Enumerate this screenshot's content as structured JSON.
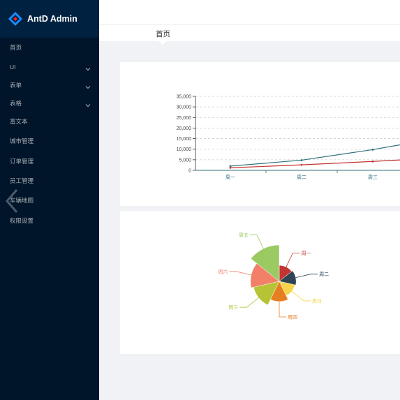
{
  "app": {
    "title": "AntD Admin"
  },
  "sidebar": {
    "items": [
      {
        "label": "首页",
        "has_submenu": false
      },
      {
        "label": "UI",
        "has_submenu": true
      },
      {
        "label": "表单",
        "has_submenu": true
      },
      {
        "label": "表格",
        "has_submenu": true
      },
      {
        "label": "富文本",
        "has_submenu": false
      },
      {
        "label": "城市管理",
        "has_submenu": false
      },
      {
        "label": "订单管理",
        "has_submenu": false
      },
      {
        "label": "员工管理",
        "has_submenu": false
      },
      {
        "label": "车辆地图",
        "has_submenu": false
      },
      {
        "label": "权限设置",
        "has_submenu": false
      }
    ]
  },
  "breadcrumb": {
    "title": "首页"
  },
  "colors": {
    "sidebar_bg": "#001529",
    "logo_bg": "#002140",
    "page_bg": "#f0f2f5",
    "logo_blue": "#1890ff",
    "logo_red": "#f5222d"
  },
  "chart_data": [
    {
      "type": "line",
      "categories": [
        "周一",
        "周二",
        "周三"
      ],
      "y_ticks": [
        "0",
        "5,000",
        "10,000",
        "15,000",
        "20,000",
        "25,000",
        "30,000",
        "35,000"
      ],
      "ylim": [
        0,
        35000
      ],
      "grid": true,
      "series": [
        {
          "color": "#2f6f7a",
          "values": [
            2000,
            4800,
            9800
          ]
        },
        {
          "color": "#c23531",
          "values": [
            1200,
            2600,
            4200
          ]
        }
      ]
    },
    {
      "type": "pie",
      "style": "rose",
      "slices": [
        {
          "label": "周一",
          "value": 5,
          "color": "#c23531"
        },
        {
          "label": "周二",
          "value": 6,
          "color": "#2f4554"
        },
        {
          "label": "周日",
          "value": 5,
          "color": "#f6d54a"
        },
        {
          "label": "周四",
          "value": 10,
          "color": "#e67e22"
        },
        {
          "label": "周三",
          "value": 20,
          "color": "#b5c334"
        },
        {
          "label": "周六",
          "value": 25,
          "color": "#f28068"
        },
        {
          "label": "周五",
          "value": 44,
          "color": "#9bca63"
        }
      ]
    }
  ]
}
